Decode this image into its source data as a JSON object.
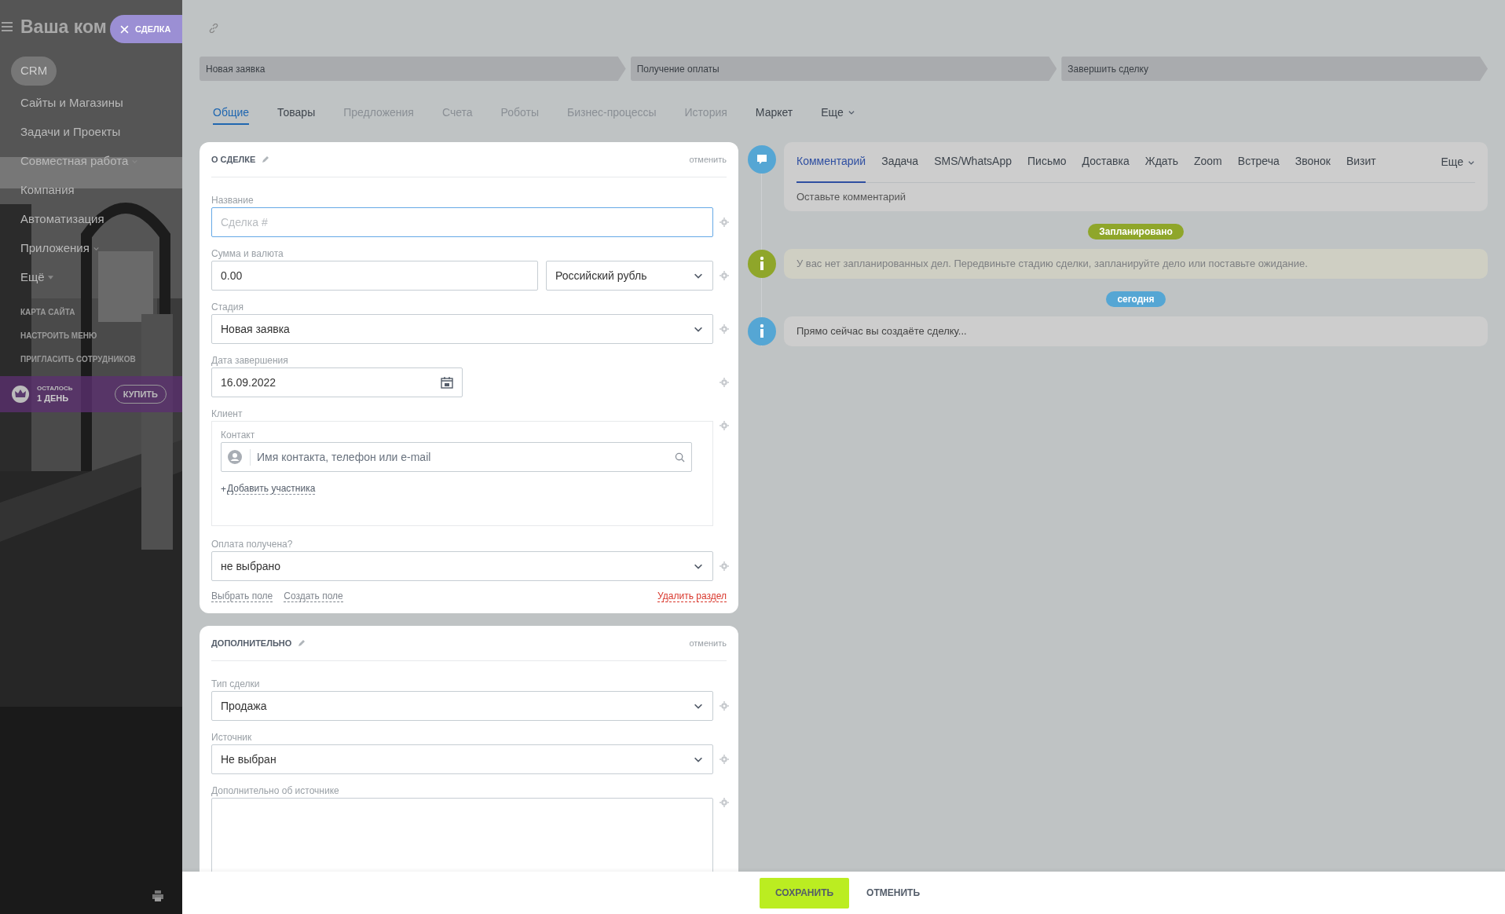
{
  "sidebar": {
    "title": "Ваша ком",
    "items": [
      {
        "label": "CRM",
        "selected": true,
        "kind": "plain"
      },
      {
        "label": "Сайты и Магазины",
        "selected": false,
        "kind": "plain"
      },
      {
        "label": "Задачи и Проекты",
        "selected": false,
        "kind": "plain"
      },
      {
        "label": "Совместная работа",
        "selected": false,
        "kind": "group"
      },
      {
        "label": "Компания",
        "selected": false,
        "kind": "plain"
      },
      {
        "label": "Автоматизация",
        "selected": false,
        "kind": "plain"
      },
      {
        "label": "Приложения",
        "selected": false,
        "kind": "group"
      },
      {
        "label": "Ещё",
        "selected": false,
        "kind": "more"
      }
    ],
    "links": [
      "КАРТА САЙТА",
      "НАСТРОИТЬ МЕНЮ",
      "ПРИГЛАСИТЬ СОТРУДНИКОВ"
    ],
    "trial": {
      "caption": "ОСТАЛОСЬ",
      "days": "1 ДЕНЬ",
      "button": "КУПИТЬ"
    }
  },
  "slider_tab": {
    "label": "СДЕЛКА"
  },
  "stages": [
    "Новая заявка",
    "Получение оплаты",
    "Завершить сделку"
  ],
  "tabs": [
    {
      "label": "Общие",
      "selected": true,
      "disabled": false,
      "kind": "tab"
    },
    {
      "label": "Товары",
      "selected": false,
      "disabled": false,
      "kind": "tab"
    },
    {
      "label": "Предложения",
      "selected": false,
      "disabled": true,
      "kind": "tab"
    },
    {
      "label": "Счета",
      "selected": false,
      "disabled": true,
      "kind": "tab"
    },
    {
      "label": "Роботы",
      "selected": false,
      "disabled": true,
      "kind": "tab"
    },
    {
      "label": "Бизнес-процессы",
      "selected": false,
      "disabled": true,
      "kind": "tab"
    },
    {
      "label": "История",
      "selected": false,
      "disabled": true,
      "kind": "tab"
    },
    {
      "label": "Маркет",
      "selected": false,
      "disabled": false,
      "kind": "tab"
    },
    {
      "label": "Еще",
      "selected": false,
      "disabled": false,
      "kind": "menu"
    }
  ],
  "sections": [
    {
      "title": "О СДЕЛКЕ",
      "cancel": "отменить",
      "fields": [
        {
          "kind": "text",
          "label": "Название",
          "placeholder": "Сделка #",
          "focused": true
        },
        {
          "kind": "money",
          "label": "Сумма и валюта",
          "value": "0.00",
          "currency": "Российский рубль"
        },
        {
          "kind": "select",
          "label": "Стадия",
          "value": "Новая заявка"
        },
        {
          "kind": "date",
          "label": "Дата завершения",
          "value": "16.09.2022"
        },
        {
          "kind": "client",
          "label": "Клиент",
          "sublabel": "Контакт",
          "placeholder": "Имя контакта, телефон или e-mail",
          "add_sign": "+",
          "add": "Добавить участника"
        },
        {
          "kind": "select",
          "label": "Оплата получена?",
          "value": "не выбрано"
        }
      ],
      "links": [
        "Выбрать поле",
        "Создать поле"
      ],
      "delete": "Удалить раздел"
    },
    {
      "title": "ДОПОЛНИТЕЛЬНО",
      "cancel": "отменить",
      "fields": [
        {
          "kind": "select",
          "label": "Тип сделки",
          "value": "Продажа"
        },
        {
          "kind": "select",
          "label": "Источник",
          "value": "Не выбран"
        },
        {
          "kind": "textarea",
          "label": "Дополнительно об источнике"
        }
      ]
    }
  ],
  "timeline": {
    "composer": {
      "tabs": [
        {
          "label": "Комментарий",
          "selected": true
        },
        {
          "label": "Задача",
          "selected": false
        },
        {
          "label": "SMS/WhatsApp",
          "selected": false
        },
        {
          "label": "Письмо",
          "selected": false
        },
        {
          "label": "Доставка",
          "selected": false
        },
        {
          "label": "Ждать",
          "selected": false
        },
        {
          "label": "Zoom",
          "selected": false
        },
        {
          "label": "Встреча",
          "selected": false
        },
        {
          "label": "Звонок",
          "selected": false
        },
        {
          "label": "Визит",
          "selected": false
        }
      ],
      "more": "Еще",
      "placeholder": "Оставьте комментарий"
    },
    "entries": [
      {
        "kind": "badge",
        "label": "Запланировано",
        "color": "#8fa62a"
      },
      {
        "kind": "note",
        "text": "У вас нет запланированных дел. Передвиньте стадию сделки, запланируйте дело или поставьте ожидание.",
        "color": "#8fa62a"
      },
      {
        "kind": "badge",
        "label": "сегодня",
        "color": "#55a6d4"
      },
      {
        "kind": "info",
        "text": "Прямо сейчас вы создаёте сделку...",
        "color": "#55a6d4"
      }
    ]
  },
  "footer": {
    "save": "СОХРАНИТЬ",
    "cancel": "ОТМЕНИТЬ"
  }
}
